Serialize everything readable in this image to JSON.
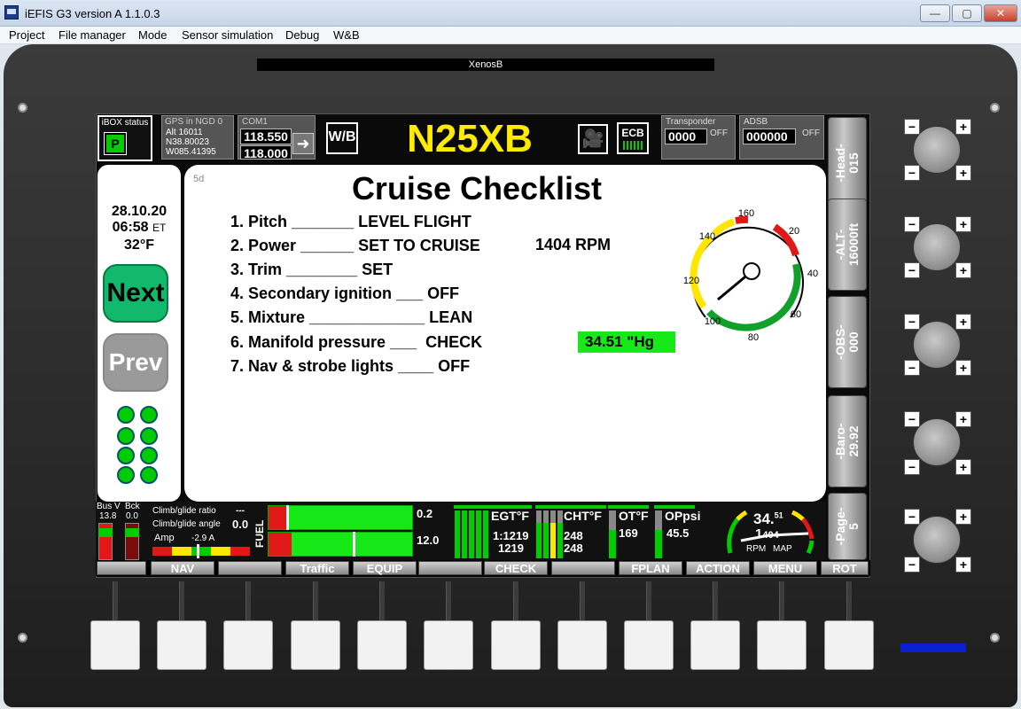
{
  "window": {
    "title": "iEFIS G3 version A 1.1.0.3",
    "buttons": {
      "minimize": "—",
      "maximize": "▢",
      "close": "✕"
    }
  },
  "menu": [
    "Project",
    "File manager",
    "Mode",
    "Sensor simulation",
    "Debug",
    "W&B"
  ],
  "device_name": "XenosB",
  "top_strip": {
    "ibox_label": "iBOX status",
    "ibox_state": "P",
    "gps_label": "GPS in NGD 0",
    "gps_alt": "Alt  16011",
    "gps_lat": "N38.80023",
    "gps_lon": "W085.41395",
    "com_label": "COM1",
    "com_active": "118.550",
    "com_standby": "118.000",
    "swap_glyph": "➜",
    "wb_logo": "W/B",
    "tail_number": "N25XB",
    "camera_glyph": "🎥",
    "ecb_label": "ECB",
    "transponder_label": "Transponder",
    "transponder_code": "0000",
    "transponder_state": "OFF",
    "adsb_label": "ADSB",
    "adsb_code": "000000",
    "adsb_state": "OFF"
  },
  "left_panel": {
    "date": "28.10.20",
    "time": "06:58",
    "time_zone": "ET",
    "temperature": "32°F",
    "next_label": "Next",
    "prev_label": "Prev"
  },
  "checklist": {
    "page_code": "5d",
    "title": "Cruise Checklist",
    "items": [
      "1. Pitch _______ LEVEL FLIGHT",
      "2. Power ______ SET TO CRUISE",
      "3. Trim ________ SET",
      "4. Secondary ignition ___ OFF",
      "5. Mixture _____________ LEAN",
      "6. Manifold pressure ___  CHECK",
      "7. Nav & strobe lights ____ OFF"
    ],
    "rpm_readout": "1404 RPM",
    "map_readout": "34.51  \"Hg",
    "gauge_ticks": [
      "160",
      "20",
      "140",
      "40",
      "120",
      "60",
      "100",
      "80"
    ]
  },
  "right_softkeys": [
    "-Head-\n015",
    "-ALT-\n16000ft",
    "-OBS-\n000",
    "-Baro-\n29.92",
    "-Page-\n5"
  ],
  "knob_buttons": {
    "minus": "−",
    "plus": "+"
  },
  "engine_strip": {
    "bus_label": "Bus V",
    "bck_label": "Bck",
    "bus_value": "13.8",
    "bck_value": "0.0",
    "climb_ratio_label": "Climb/glide ratio",
    "climb_ratio_value": "---",
    "climb_angle_label": "Climb/glide angle",
    "climb_angle_value": "0.0",
    "amp_label": "Amp",
    "amp_value": "-2.9 A",
    "fuel_label": "FUEL",
    "fuel_flow": "0.2",
    "fuel_qty": "12.0",
    "egt_label": "EGT°F",
    "egt_value1": "1:1219",
    "egt_value2": "1219",
    "cht_label": "CHT°F",
    "cht_value1": "248",
    "cht_value2": "248",
    "ot_label": "OT°F",
    "ot_value": "169",
    "op_label": "OPpsi",
    "op_value": "45.5",
    "map_value": "34.",
    "map_decimal": "51",
    "rpm_value": "1",
    "rpm_decimal": "404",
    "rpm_label": "RPM",
    "map_label": "MAP"
  },
  "bottom_softkeys": [
    "",
    "NAV",
    "",
    "Traffic",
    "EQUIP",
    "",
    "CHECK",
    "",
    "FPLAN",
    "ACTION",
    "MENU",
    "ROT"
  ]
}
